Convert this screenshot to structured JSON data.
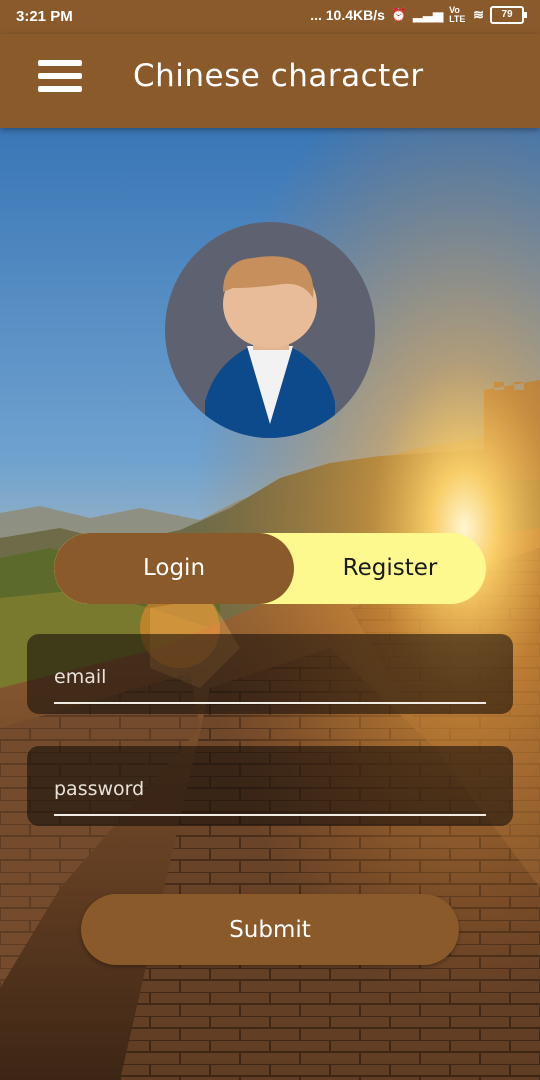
{
  "status_bar": {
    "time": "3:21 PM",
    "network_speed": "... 10.4KB/s",
    "alarm_icon": "alarm-icon",
    "signal_icon": "signal-icon",
    "volte_label": "Vo LTE",
    "wifi_icon": "wifi-icon",
    "battery_level": "79"
  },
  "app_bar": {
    "menu_icon": "hamburger-menu-icon",
    "title": "Chinese character"
  },
  "colors": {
    "brand_brown": "#8a5a2b",
    "toggle_inactive": "#fdf98e",
    "avatar_bg": "#5e6270",
    "avatar_shirt": "#0d4a8c"
  },
  "auth_toggle": {
    "login_label": "Login",
    "register_label": "Register",
    "active": "Login"
  },
  "form": {
    "email_placeholder": "email",
    "email_value": "",
    "password_placeholder": "password",
    "password_value": "",
    "submit_label": "Submit"
  }
}
